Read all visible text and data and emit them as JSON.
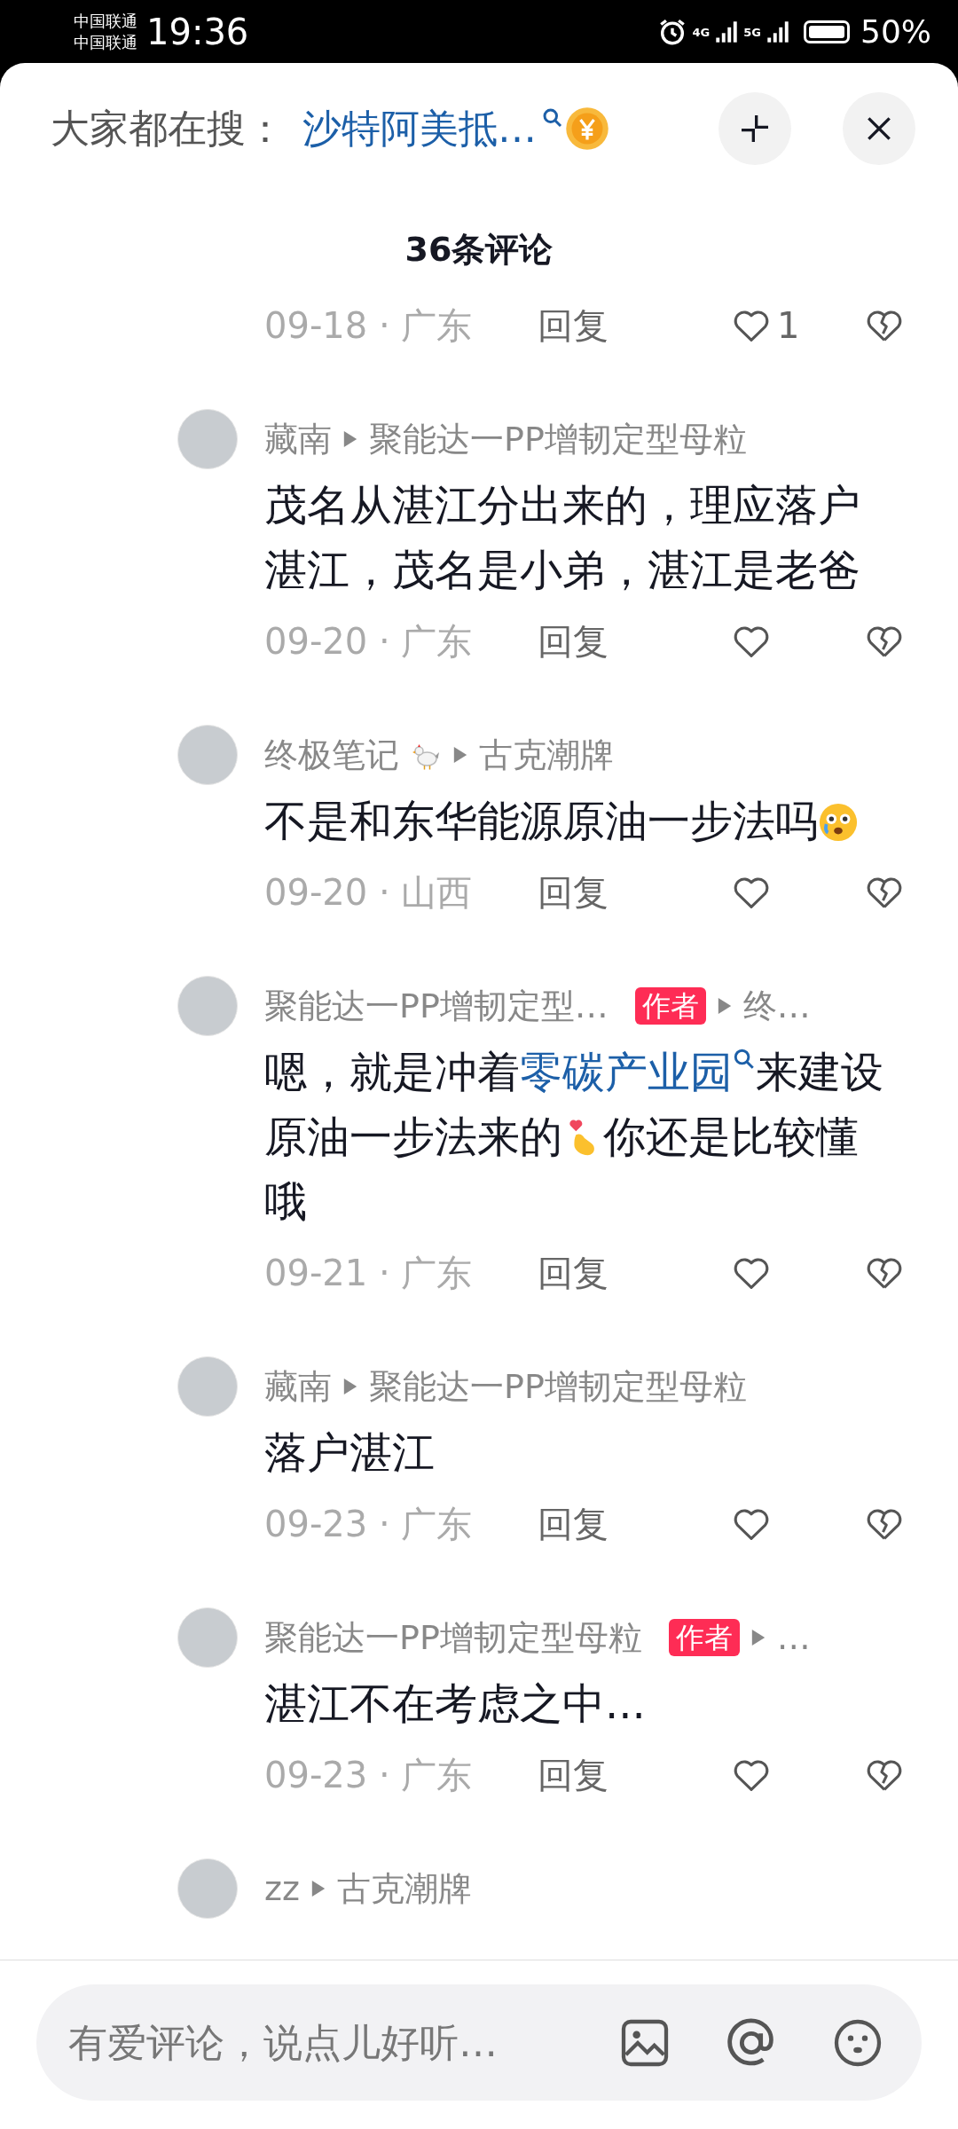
{
  "status_bar": {
    "carriers": [
      "中国联通",
      "中国联通"
    ],
    "time": "19:36",
    "network_1": "4G",
    "network_2": "5G",
    "battery": "50%"
  },
  "header": {
    "label": "大家都在搜：",
    "search_link": "沙特阿美抵…"
  },
  "title": "36条评论",
  "top_meta": {
    "date": "09-18 · 广东",
    "reply": "回复",
    "likes": "1"
  },
  "comments": [
    {
      "name": "藏南",
      "author": false,
      "reply_to": "聚能达一PP增韧定型母粒",
      "segments": [
        {
          "kind": "text",
          "text": "茂名从湛江分出来的，理应落户湛江，茂名是小弟，湛江是老爸"
        }
      ],
      "date": "09-20 · 广东",
      "reply": "回复"
    },
    {
      "name": "终极笔记",
      "name_emoji": true,
      "author": false,
      "reply_to": "古克潮牌",
      "segments": [
        {
          "kind": "text",
          "text": "不是和东华能源原油一步法吗"
        },
        {
          "kind": "face"
        }
      ],
      "date": "09-20 · 山西",
      "reply": "回复"
    },
    {
      "name": "聚能达一PP增韧定型…",
      "author": true,
      "author_label": "作者",
      "reply_to": "终…",
      "segments": [
        {
          "kind": "text",
          "text": "嗯，就是冲着"
        },
        {
          "kind": "link",
          "text": "零碳产业园"
        },
        {
          "kind": "text",
          "text": "来建设原油一步法来的"
        },
        {
          "kind": "fingerheart"
        },
        {
          "kind": "text",
          "text": "你还是比较懂哦"
        }
      ],
      "date": "09-21 · 广东",
      "reply": "回复"
    },
    {
      "name": "藏南",
      "author": false,
      "reply_to": "聚能达一PP增韧定型母粒",
      "segments": [
        {
          "kind": "text",
          "text": "落户湛江"
        }
      ],
      "date": "09-23 · 广东",
      "reply": "回复"
    },
    {
      "name": "聚能达一PP增韧定型母粒",
      "author": true,
      "author_label": "作者",
      "reply_to": "…",
      "segments": [
        {
          "kind": "text",
          "text": "湛江不在考虑之中..."
        }
      ],
      "date": "09-23 · 广东",
      "reply": "回复"
    },
    {
      "name": "zz",
      "author": false,
      "reply_to": "古克潮牌"
    }
  ],
  "input": {
    "placeholder": "有爱评论，说点儿好听…"
  }
}
